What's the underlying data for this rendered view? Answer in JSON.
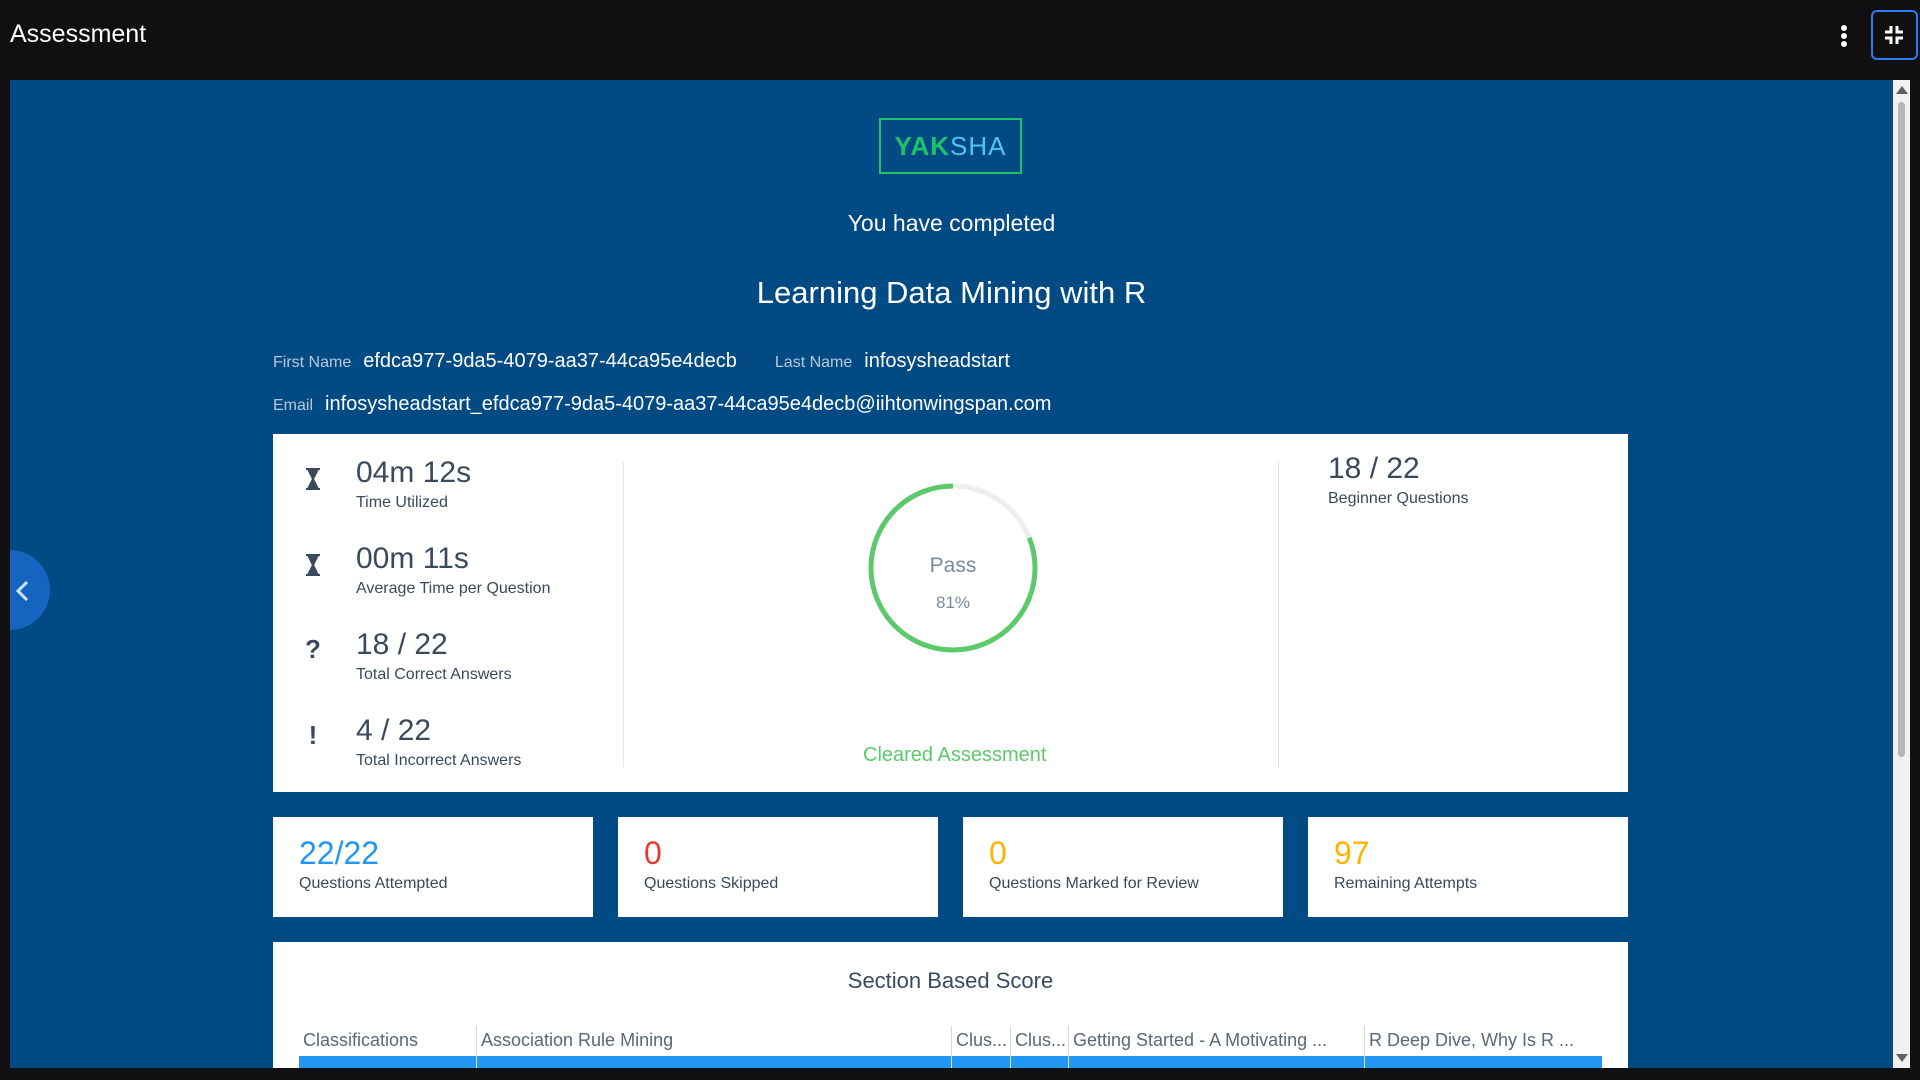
{
  "app": {
    "title": "Assessment"
  },
  "logo": {
    "part1": "YAK",
    "part2": "SHA"
  },
  "header": {
    "completed_text": "You have completed",
    "course_title": "Learning Data Mining with R"
  },
  "user": {
    "first_name_label": "First Name",
    "first_name": "efdca977-9da5-4079-aa37-44ca95e4decb",
    "last_name_label": "Last Name",
    "last_name": "infosysheadstart",
    "email_label": "Email",
    "email": "infosysheadstart_efdca977-9da5-4079-aa37-44ca95e4decb@iihtonwingspan.com"
  },
  "stats": [
    {
      "icon": "hourglass-icon",
      "value": "04m 12s",
      "label": "Time Utilized"
    },
    {
      "icon": "hourglass-icon",
      "value": "00m 11s",
      "label": "Average Time per Question"
    },
    {
      "icon": "question-icon",
      "value": "18 / 22",
      "label": "Total Correct Answers"
    },
    {
      "icon": "exclamation-icon",
      "value": "4 / 22",
      "label": "Total Incorrect Answers"
    }
  ],
  "gauge": {
    "status": "Pass",
    "percent_text": "81%",
    "percent": 81,
    "color": "#5cc96a",
    "result": "Cleared Assessment"
  },
  "levels": {
    "value": "18 / 22",
    "label": "Beginner Questions"
  },
  "summary": [
    {
      "value": "22/22",
      "label": "Questions Attempted",
      "color": "#2196f3"
    },
    {
      "value": "0",
      "label": "Questions Skipped",
      "color": "#e53935"
    },
    {
      "value": "0",
      "label": "Questions Marked for Review",
      "color": "#ffb300"
    },
    {
      "value": "97",
      "label": "Remaining Attempts",
      "color": "#ffb300"
    }
  ],
  "section_score": {
    "title": "Section Based Score",
    "sections": [
      "Classifications",
      "Association Rule Mining",
      "Clus...",
      "Clus...",
      "Getting Started - A Motivating ...",
      "R Deep Dive, Why Is R ..."
    ],
    "bar_color": "#2196f3"
  },
  "colors": {
    "frame_bg": "#024a83",
    "topbar_bg": "#101010",
    "accent": "#2b7bf0"
  }
}
